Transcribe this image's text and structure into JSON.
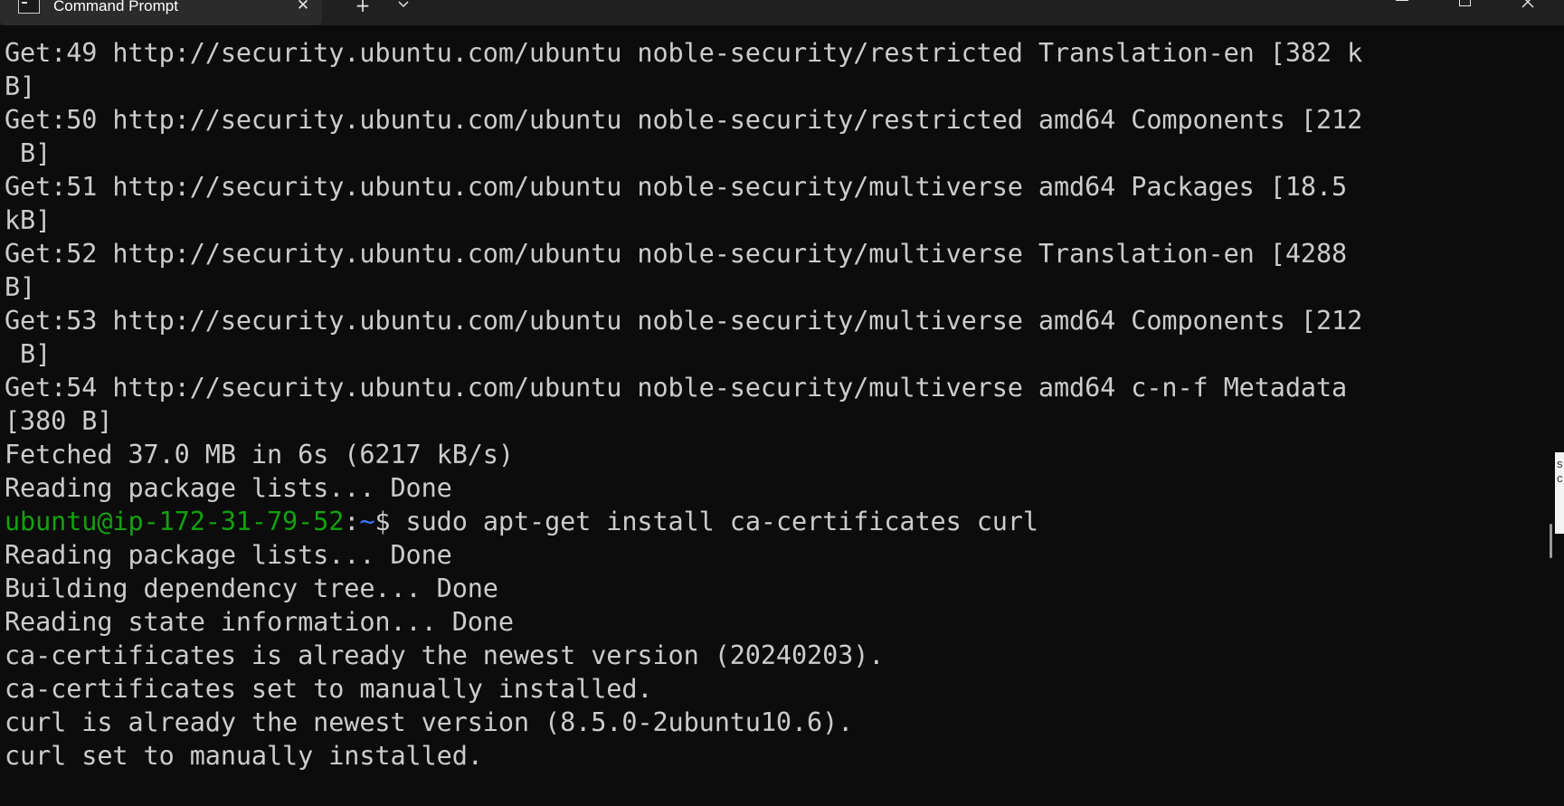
{
  "window": {
    "tab_title": "Command Prompt",
    "new_tab_symbol": "+",
    "close_symbol": "✕"
  },
  "terminal": {
    "colors": {
      "background": "#0c0c0c",
      "foreground": "#cccccc",
      "prompt_user": "#13a10e",
      "prompt_path": "#3b78ff"
    },
    "lines_before_prompt": [
      "Get:49 http://security.ubuntu.com/ubuntu noble-security/restricted Translation-en [382 k",
      "B]",
      "Get:50 http://security.ubuntu.com/ubuntu noble-security/restricted amd64 Components [212",
      " B]",
      "Get:51 http://security.ubuntu.com/ubuntu noble-security/multiverse amd64 Packages [18.5",
      "kB]",
      "Get:52 http://security.ubuntu.com/ubuntu noble-security/multiverse Translation-en [4288",
      "B]",
      "Get:53 http://security.ubuntu.com/ubuntu noble-security/multiverse amd64 Components [212",
      " B]",
      "Get:54 http://security.ubuntu.com/ubuntu noble-security/multiverse amd64 c-n-f Metadata",
      "[380 B]",
      "Fetched 37.0 MB in 6s (6217 kB/s)",
      "Reading package lists... Done"
    ],
    "prompt": {
      "user_host": "ubuntu@ip-172-31-79-52",
      "separator": ":",
      "path": "~",
      "symbol": "$",
      "command": " sudo apt-get install ca-certificates curl"
    },
    "lines_after_prompt": [
      "Reading package lists... Done",
      "Building dependency tree... Done",
      "Reading state information... Done",
      "ca-certificates is already the newest version (20240203).",
      "ca-certificates set to manually installed.",
      "curl is already the newest version (8.5.0-2ubuntu10.6).",
      "curl set to manually installed."
    ]
  },
  "background_window_text": "s\nc"
}
